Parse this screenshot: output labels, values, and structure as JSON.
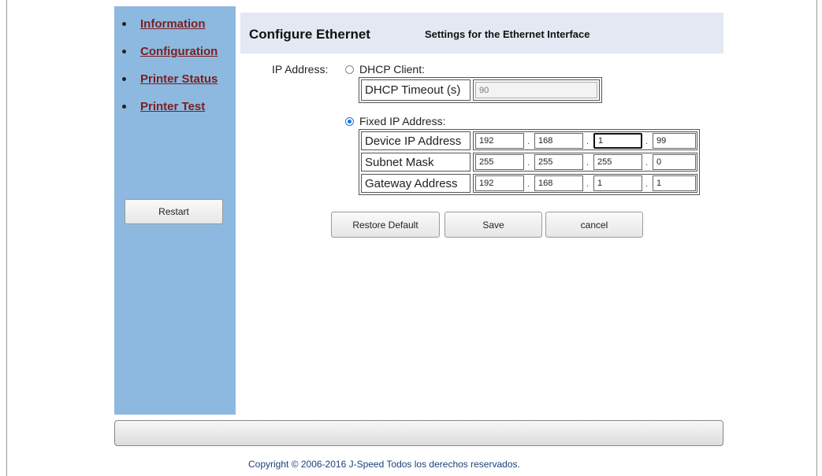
{
  "sidebar": {
    "items": [
      {
        "label": "Information"
      },
      {
        "label": "Configuration"
      },
      {
        "label": "Printer Status"
      },
      {
        "label": "Printer Test"
      }
    ],
    "restart_label": "Restart"
  },
  "header": {
    "title": "Configure Ethernet",
    "subtitle": "Settings for the Ethernet Interface"
  },
  "form": {
    "ip_address_label": "IP Address:",
    "dhcp_client_label": "DHCP Client:",
    "dhcp_client_selected": false,
    "dhcp_timeout_label": "DHCP Timeout (s)",
    "dhcp_timeout_value": "90",
    "fixed_ip_label": "Fixed IP Address:",
    "fixed_ip_selected": true,
    "rows": [
      {
        "label": "Device IP Address",
        "octets": [
          "192",
          "168",
          "1",
          "99"
        ]
      },
      {
        "label": "Subnet Mask",
        "octets": [
          "255",
          "255",
          "255",
          "0"
        ]
      },
      {
        "label": "Gateway Address",
        "octets": [
          "192",
          "168",
          "1",
          "1"
        ]
      }
    ],
    "octet_separator": "."
  },
  "actions": {
    "restore_default_label": "Restore Default",
    "save_label": "Save",
    "cancel_label": "cancel"
  },
  "footer": {
    "copyright": "Copyright © 2006-2016 J-Speed Todos los derechos reservados."
  },
  "colors": {
    "sidebar_bg": "#8db9e0",
    "header_bg": "#e3e8f3",
    "link": "#7a1f1f",
    "radio_accent": "#1a73e8",
    "footer_text": "#1d3f7a"
  }
}
